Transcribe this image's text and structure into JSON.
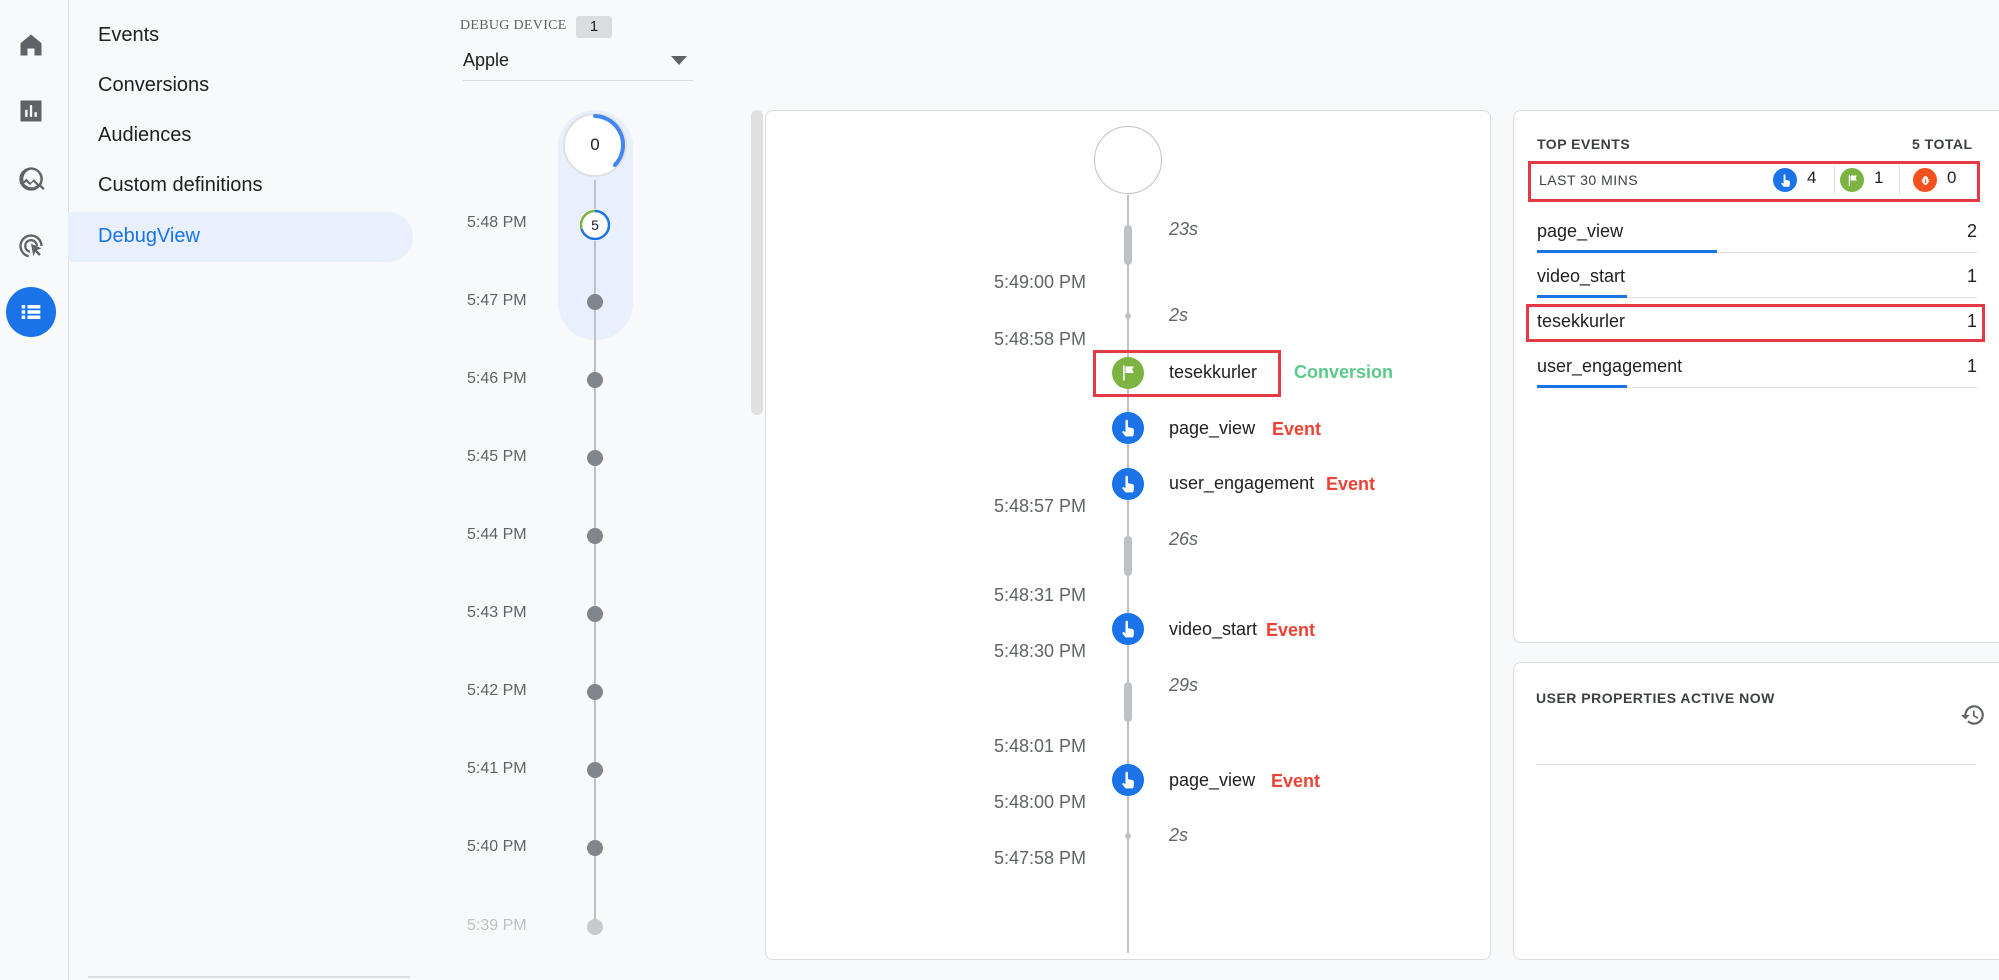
{
  "rail": {
    "icons": [
      "home-icon",
      "reports-icon",
      "explore-icon",
      "advertising-icon",
      "configure-icon"
    ]
  },
  "nav": {
    "items": [
      "Events",
      "Conversions",
      "Audiences",
      "Custom definitions",
      "DebugView"
    ],
    "active": "DebugView"
  },
  "debug_device": {
    "label": "DEBUG DEVICE",
    "count": "1",
    "selected": "Apple"
  },
  "minute_timeline": {
    "current_count": "0",
    "latest_minute_count": "5",
    "times": [
      "5:48 PM",
      "5:47 PM",
      "5:46 PM",
      "5:45 PM",
      "5:44 PM",
      "5:43 PM",
      "5:42 PM",
      "5:41 PM",
      "5:40 PM",
      "5:39 PM"
    ]
  },
  "stream": {
    "gaps": [
      "23s",
      "2s",
      "26s",
      "29s",
      "2s"
    ],
    "times": [
      "5:49:00 PM",
      "5:48:58 PM",
      "5:48:57 PM",
      "5:48:31 PM",
      "5:48:30 PM",
      "5:48:01 PM",
      "5:48:00 PM",
      "5:47:58 PM"
    ],
    "events": [
      {
        "name": "tesekkurler",
        "type": "Conversion",
        "icon": "flag-icon"
      },
      {
        "name": "page_view",
        "type": "Event",
        "icon": "touch-icon"
      },
      {
        "name": "user_engagement",
        "type": "Event",
        "icon": "touch-icon"
      },
      {
        "name": "video_start",
        "type": "Event",
        "icon": "touch-icon"
      },
      {
        "name": "page_view",
        "type": "Event",
        "icon": "touch-icon"
      }
    ]
  },
  "top_events": {
    "title": "TOP EVENTS",
    "total": "5 TOTAL",
    "period": "LAST 30 MINS",
    "counts": {
      "events": "4",
      "conversions": "1",
      "errors": "0"
    },
    "rows": [
      {
        "name": "page_view",
        "count": "2",
        "share": 1.0
      },
      {
        "name": "video_start",
        "count": "1",
        "share": 0.5
      },
      {
        "name": "tesekkurler",
        "count": "1",
        "share": 0.5
      },
      {
        "name": "user_engagement",
        "count": "1",
        "share": 0.5
      }
    ]
  },
  "user_properties": {
    "title": "USER PROPERTIES ACTIVE NOW"
  },
  "colors": {
    "accent": "#1a73e8",
    "conversion": "#7cb342",
    "error": "#f4511e",
    "event_label": "#ea4335",
    "highlight": "#e53945"
  }
}
